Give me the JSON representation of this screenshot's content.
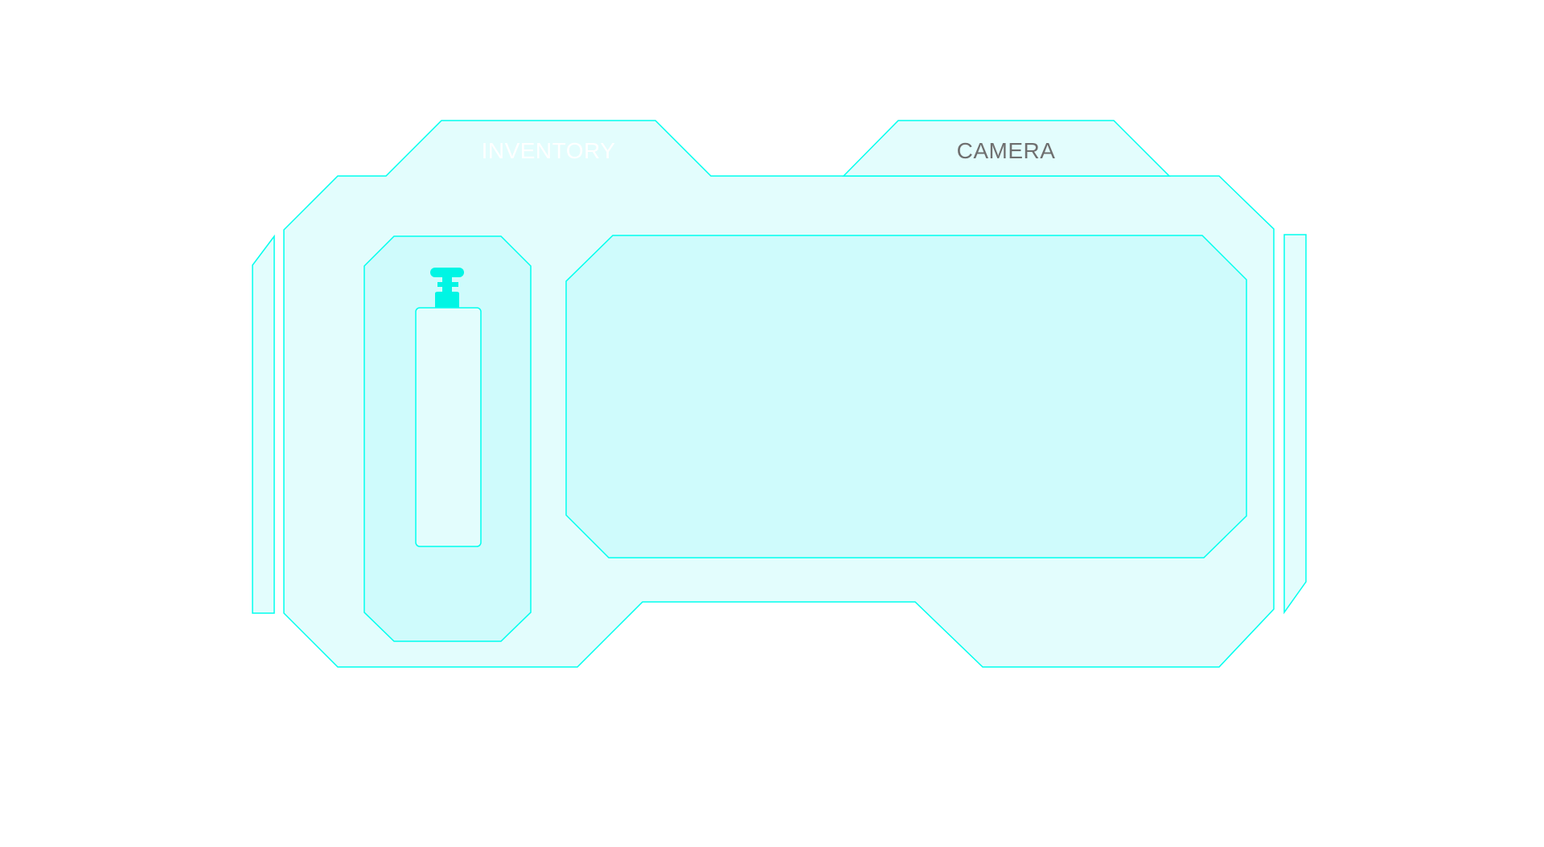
{
  "tabs": {
    "inventory": {
      "label": "INVENTORY",
      "active": false
    },
    "camera": {
      "label": "CAMERA",
      "active": true
    }
  },
  "inventory": {
    "slots": [
      {
        "item": "oxygen-tank",
        "icon": "gas-cylinder-icon"
      }
    ]
  },
  "camera": {
    "viewport": "camera-feed"
  },
  "colors": {
    "outline": "#00ffee",
    "panel_fill": "#e3fdfd",
    "inner_fill": "#cffbfc",
    "tab_inactive_text": "#ffffff",
    "tab_active_text": "#6f6f6f",
    "icon_fill": "#00f5e4"
  }
}
